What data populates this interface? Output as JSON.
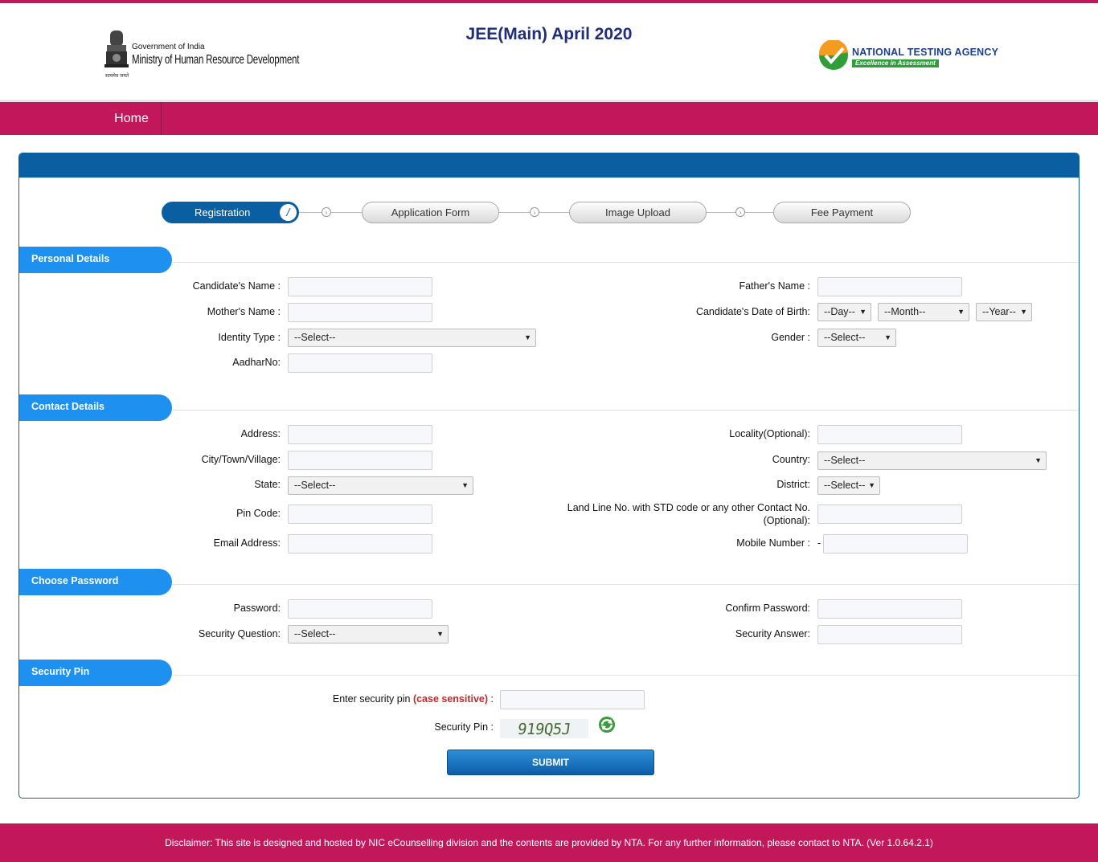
{
  "header": {
    "ministry_small": "Government of India",
    "ministry_big": "Ministry of Human Resource Development",
    "emblem_motto": "सत्यमेव जयते",
    "title": "JEE(Main) April 2020",
    "nta_name": "NATIONAL TESTING AGENCY",
    "nta_tagline": "Excellence in Assessment"
  },
  "nav": {
    "home": "Home"
  },
  "steps": [
    "Registration",
    "Application Form",
    "Image Upload",
    "Fee Payment"
  ],
  "sections": {
    "personal": "Personal Details",
    "contact": "Contact Details",
    "password": "Choose Password",
    "pin": "Security Pin"
  },
  "personal": {
    "candidate_name": "Candidate's Name :",
    "mother_name": "Mother's Name :",
    "identity_type": "Identity Type :",
    "aadhar": "AadharNo:",
    "father_name": "Father's Name :",
    "dob": "Candidate's Date of Birth:",
    "gender": "Gender :",
    "select": "--Select--",
    "day": "--Day--",
    "month": "--Month--",
    "year": "--Year--"
  },
  "contact": {
    "address": "Address:",
    "city": "City/Town/Village:",
    "state": "State:",
    "pin_code": "Pin Code:",
    "email": "Email Address:",
    "locality": "Locality(Optional):",
    "country": "Country:",
    "district": "District:",
    "landline_1": "Land Line No. with STD code or any other Contact No.",
    "landline_2": "(Optional):",
    "mobile": "Mobile Number :",
    "mobile_prefix": "-"
  },
  "password": {
    "password": "Password:",
    "security_question": "Security Question:",
    "confirm": "Confirm Password:",
    "security_answer": "Security Answer:"
  },
  "pin": {
    "enter_prefix": "Enter security pin",
    "enter_note": "(case sensitive)",
    "enter_suffix": " :",
    "label": "Security Pin :",
    "captcha": "919Q5J"
  },
  "submit": "SUBMIT",
  "footer": "Disclaimer: This site is designed and hosted by NIC eCounselling division and the contents are provided by NTA. For any further information, please contact to NTA. (Ver 1.0.64.2.1)",
  "colors": {
    "brand": "#c2185b",
    "primary": "#0a5fa3",
    "section": "#1e90f0"
  }
}
